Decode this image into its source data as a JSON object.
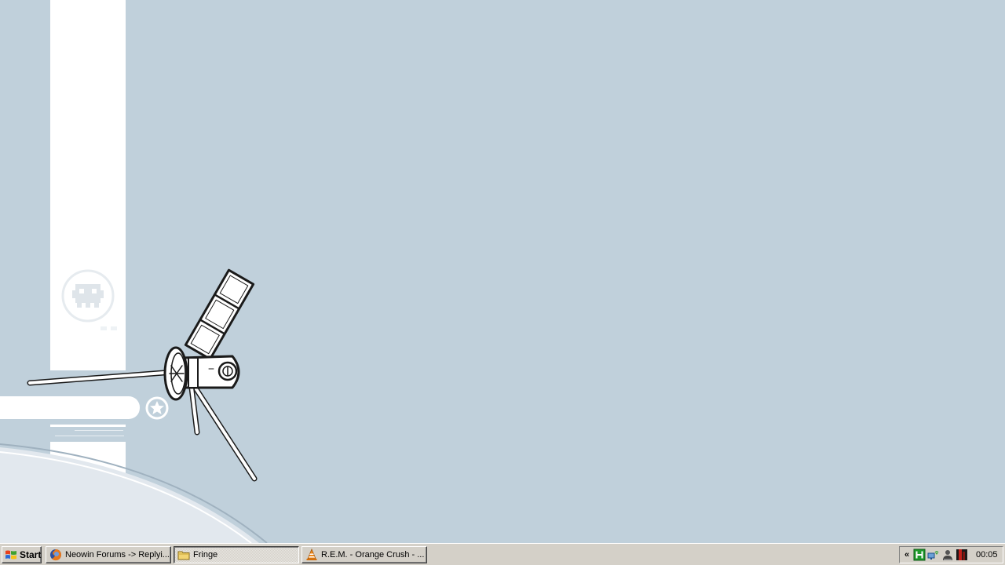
{
  "taskbar": {
    "start_label": "Start",
    "tasks": [
      {
        "label": "Neowin Forums -> Replyi...",
        "icon": "firefox-icon",
        "active": false
      },
      {
        "label": "Fringe",
        "icon": "folder-icon",
        "active": true
      },
      {
        "label": "R.E.M. - Orange Crush - ...",
        "icon": "vlc-cone-icon",
        "active": false
      }
    ],
    "tray": {
      "chevron": "«",
      "icons": [
        "green-h-icon",
        "network-icon",
        "user-icon",
        "red-black-icon"
      ],
      "clock": "00:05"
    }
  },
  "colors": {
    "desktop": "#c0d0db",
    "taskbar": "#d4d0c8"
  }
}
